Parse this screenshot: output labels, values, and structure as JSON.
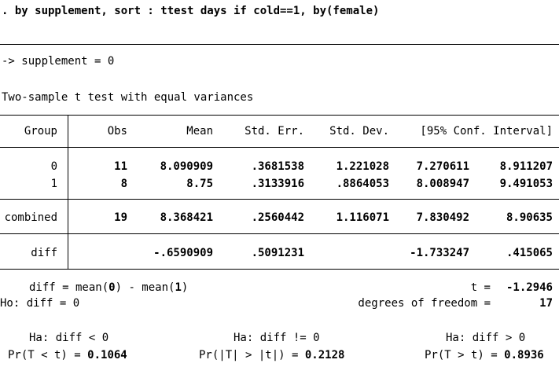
{
  "command": ". by supplement, sort : ttest days if cold==1, by(female)",
  "by_group": "-> supplement = 0",
  "test_title": "Two-sample t test with equal variances",
  "table": {
    "headers": {
      "group": "Group",
      "obs": "Obs",
      "mean": "Mean",
      "se": "Std. Err.",
      "sd": "Std. Dev.",
      "ci": "[95% Conf. Interval]"
    },
    "rows": [
      {
        "group": "0",
        "obs": "11",
        "mean": "8.090909",
        "se": ".3681538",
        "sd": "1.221028",
        "ci_low": "7.270611",
        "ci_high": "8.911207"
      },
      {
        "group": "1",
        "obs": "8",
        "mean": "8.75",
        "se": ".3133916",
        "sd": ".8864053",
        "ci_low": "8.008947",
        "ci_high": "9.491053"
      }
    ],
    "combined": {
      "group": "combined",
      "obs": "19",
      "mean": "8.368421",
      "se": ".2560442",
      "sd": "1.116071",
      "ci_low": "7.830492",
      "ci_high": "8.90635"
    },
    "diff": {
      "group": "diff",
      "mean": "-.6590909",
      "se": ".5091231",
      "ci_low": "-1.733247",
      "ci_high": ".415065"
    }
  },
  "stats": {
    "diff_def_prefix": "diff = mean(",
    "diff_def_g0": "0",
    "diff_def_mid": ") - mean(",
    "diff_def_g1": "1",
    "diff_def_suffix": ")",
    "t_label": "t =",
    "t_value": "-1.2946",
    "h0": "Ho: diff = 0",
    "df_label": "degrees of freedom =",
    "df_value": "17"
  },
  "alternatives": [
    {
      "ha": "Ha: diff < 0",
      "pr_label": "Pr(T < t) =",
      "pr_value": "0.1064"
    },
    {
      "ha": "Ha: diff != 0",
      "pr_label": "Pr(|T| > |t|) =",
      "pr_value": "0.2128"
    },
    {
      "ha": "Ha: diff > 0",
      "pr_label": "Pr(T > t) =",
      "pr_value": "0.8936"
    }
  ]
}
